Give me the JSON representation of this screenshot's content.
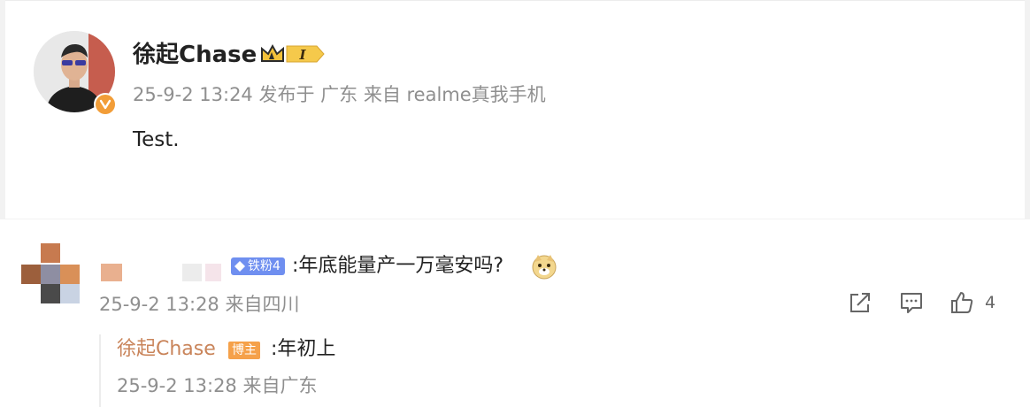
{
  "post": {
    "author": "徐起Chase",
    "meta": "25-9-2 13:24  发布于 广东  来自 realme真我手机",
    "text": "Test.",
    "crown_badge_level": "I"
  },
  "comment": {
    "fan_badge": "铁粉4",
    "text": ":年底能量产一万毫安吗?",
    "meta": "25-9-2 13:28 来自四川",
    "like_count": "4"
  },
  "reply": {
    "author": "徐起Chase",
    "badge": "博主",
    "text": ":年初上",
    "meta": "25-9-2 13:28 来自广东"
  },
  "colors": {
    "verified": "#f29d38",
    "fan_badge": "#6f8ff0",
    "reply_author": "#c9845a",
    "host_badge": "#f5a14a"
  }
}
